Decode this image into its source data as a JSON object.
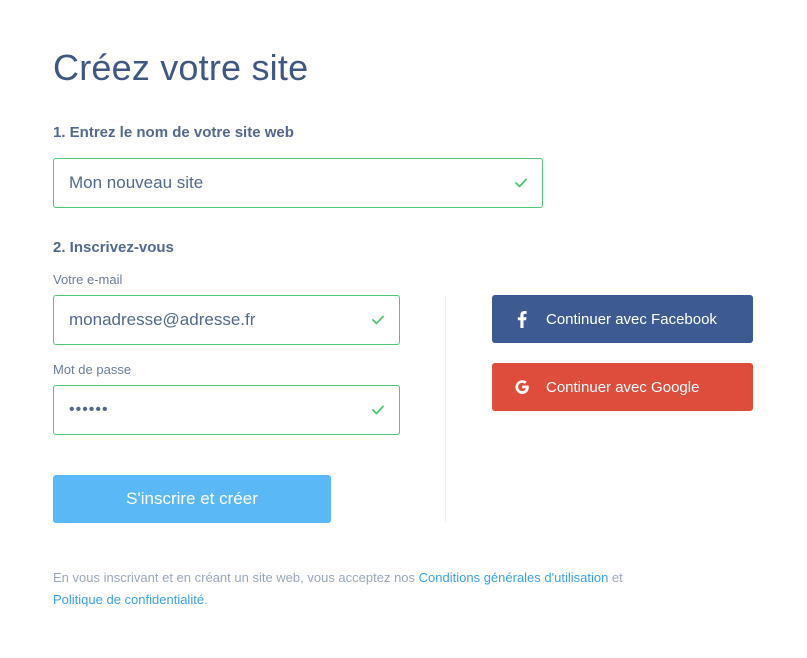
{
  "page": {
    "title": "Créez votre site"
  },
  "step1": {
    "label": "1. Entrez le nom de votre site web",
    "site_name_value": "Mon nouveau site"
  },
  "step2": {
    "label": "2. Inscrivez-vous",
    "email_label": "Votre e-mail",
    "email_value": "monadresse@adresse.fr",
    "password_label": "Mot de passe",
    "password_value": "••••••",
    "submit_label": "S'inscrire et créer"
  },
  "social": {
    "facebook_label": "Continuer avec Facebook",
    "google_label": "Continuer avec Google"
  },
  "legal": {
    "prefix": "En vous inscrivant et en créant un site web, vous acceptez nos ",
    "terms_link": "Conditions générales d'utilisation",
    "middle": " et",
    "privacy_link": "Politique de confidentialité",
    "suffix": "."
  },
  "icons": {
    "valid": "check-icon",
    "facebook": "facebook-icon",
    "google": "google-icon"
  },
  "colors": {
    "title": "#3e5783",
    "valid_border": "#4fc774",
    "facebook": "#3e5a93",
    "google": "#de4d3b",
    "submit": "#5bb8f6",
    "link": "#3aa1ec"
  }
}
